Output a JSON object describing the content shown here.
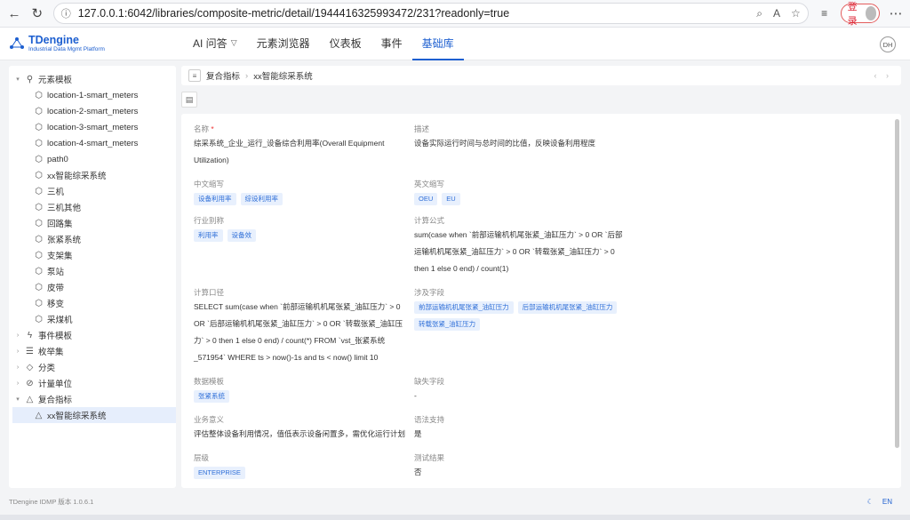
{
  "browser": {
    "url": "127.0.0.1:6042/libraries/composite-metric/detail/1944416325993472/231?readonly=true",
    "login_label": "登录"
  },
  "app": {
    "logo_title": "TDengine",
    "logo_sub": "Industrial Data Mgmt Platform",
    "user_initials": "DH",
    "nav": [
      {
        "label": "AI 问答"
      },
      {
        "label": "元素浏览器"
      },
      {
        "label": "仪表板"
      },
      {
        "label": "事件"
      },
      {
        "label": "基础库"
      }
    ]
  },
  "sidebar": {
    "root1": "元素模板",
    "templates": [
      "location-1-smart_meters",
      "location-2-smart_meters",
      "location-3-smart_meters",
      "location-4-smart_meters",
      "path0",
      "xx智能综采系统",
      "三机",
      "三机其他",
      "回路集",
      "张紧系统",
      "支架集",
      "泵站",
      "皮带",
      "移变",
      "采煤机"
    ],
    "roots": [
      "事件模板",
      "枚举集",
      "分类",
      "计量单位"
    ],
    "composite_root": "复合指标",
    "composite_child": "xx智能综采系统"
  },
  "breadcrumb": {
    "root": "复合指标",
    "current": "xx智能综采系统"
  },
  "detail": {
    "name_label": "名称",
    "name_value": "综采系统_企业_运行_设备综合利用率(Overall Equipment Utilization)",
    "desc_label": "描述",
    "desc_value": "设备实际运行时间与总时间的比值，反映设备利用程度",
    "cn_abbr_label": "中文缩写",
    "cn_abbr_tags": [
      "设备利用率",
      "综设利用率"
    ],
    "en_abbr_label": "英文缩写",
    "en_abbr_tags": [
      "OEU",
      "EU"
    ],
    "alias_label": "行业别称",
    "alias_tags": [
      "利用率",
      "设备效"
    ],
    "formula_label": "计算公式",
    "formula_value": "sum(case when `前部运输机机尾张紧_油缸压力` > 0 OR `后部运输机机尾张紧_油缸压力` > 0 OR `转载张紧_油缸压力` > 0 then 1 else 0 end) / count(1)",
    "caliber_label": "计算口径",
    "caliber_value": "SELECT sum(case when `前部运输机机尾张紧_油缸压力` > 0 OR `后部运输机机尾张紧_油缸压力` > 0 OR `转载张紧_油缸压力` > 0 then 1 else 0 end) / count(*) FROM `vst_张紧系统_571954` WHERE ts > now()-1s and ts < now() limit 10",
    "fields_label": "涉及字段",
    "fields_tags": [
      "前部运输机机尾张紧_油缸压力",
      "后部运输机机尾张紧_油缸压力",
      "转载张紧_油缸压力"
    ],
    "datatpl_label": "数据模板",
    "datatpl_tags": [
      "张紧系统"
    ],
    "missing_label": "缺失字段",
    "missing_value": "-",
    "meaning_label": "业务意义",
    "meaning_value": "评估整体设备利用情况，值低表示设备闲置多，需优化运行计划",
    "syntax_label": "语法支持",
    "syntax_value": "是",
    "level_label": "层级",
    "level_tags": [
      "ENTERPRISE"
    ],
    "test_label": "测试结果",
    "test_value": "否"
  },
  "footer": {
    "version": "TDengine IDMP 版本 1.0.6.1",
    "lang": "EN"
  }
}
